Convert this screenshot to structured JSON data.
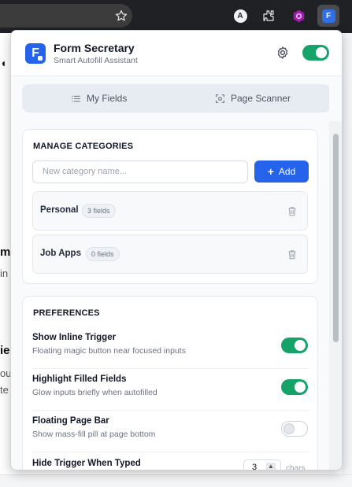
{
  "browser": {
    "account_initial": "A",
    "extension_initial": "F"
  },
  "background_page": {
    "fragments": [
      "ma",
      "in",
      "ie",
      "ou",
      "te"
    ]
  },
  "header": {
    "logo_letter": "F",
    "title": "Form Secretary",
    "subtitle": "Smart Autofill Assistant",
    "master_enabled": true,
    "accent_color": "#2563eb",
    "toggle_on_color": "#16a36a"
  },
  "tabs": [
    {
      "label": "My Fields",
      "icon": "list-icon"
    },
    {
      "label": "Page Scanner",
      "icon": "scan-icon"
    }
  ],
  "categories": {
    "title": "MANAGE CATEGORIES",
    "input_placeholder": "New category name...",
    "add_label": "Add",
    "items": [
      {
        "name": "Personal",
        "count": "3 fields"
      },
      {
        "name": "Job Apps",
        "count": "0 fields"
      }
    ]
  },
  "preferences": {
    "title": "PREFERENCES",
    "items": [
      {
        "label": "Show Inline Trigger",
        "desc": "Floating magic button near focused inputs",
        "enabled": true
      },
      {
        "label": "Highlight Filled Fields",
        "desc": "Glow inputs briefly when autofilled",
        "enabled": true
      },
      {
        "label": "Floating Page Bar",
        "desc": "Show mass-fill pill at page bottom",
        "enabled": false
      },
      {
        "label": "Hide Trigger When Typed",
        "value": "3",
        "unit": "chars"
      }
    ]
  }
}
